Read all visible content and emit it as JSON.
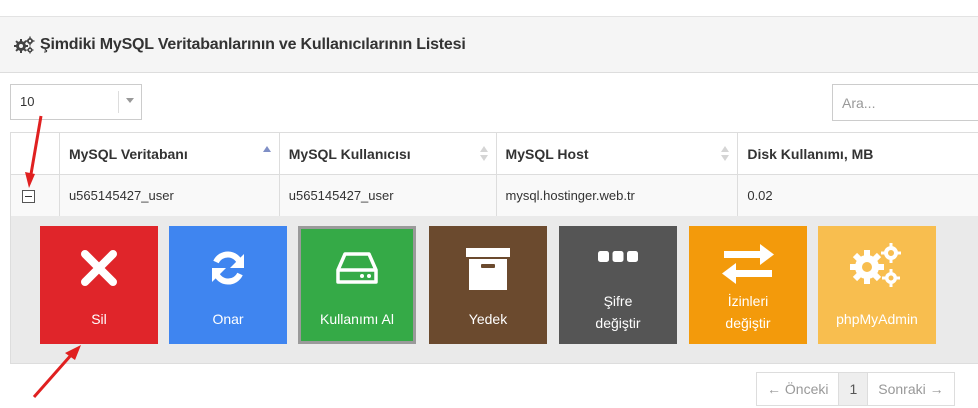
{
  "panel": {
    "title": "Şimdiki MySQL Veritabanlarının ve Kullanıcılarının Listesi",
    "icon": "gears-icon"
  },
  "length": {
    "selected": "10"
  },
  "search": {
    "placeholder": "Ara..."
  },
  "table": {
    "columns": [
      {
        "label": "MySQL Veritabanı",
        "sort": "asc"
      },
      {
        "label": "MySQL Kullanıcısı",
        "sort": "both"
      },
      {
        "label": "MySQL Host",
        "sort": "both"
      },
      {
        "label": "Disk Kullanımı, MB",
        "sort": "none"
      }
    ],
    "rows": [
      {
        "database": "u565145427_user",
        "user": "u565145427_user",
        "host": "mysql.hostinger.web.tr",
        "disk": "0.02"
      }
    ]
  },
  "actions": [
    {
      "label": "Sil",
      "icon": "close-icon",
      "color": "#e0252a"
    },
    {
      "label": "Onar",
      "icon": "refresh-icon",
      "color": "#3f85f0"
    },
    {
      "label": "Kullanımı Al",
      "icon": "hard-drive-icon",
      "color": "#35aa47"
    },
    {
      "label": "Yedek",
      "icon": "archive-icon",
      "color": "#6b4a2e"
    },
    {
      "label_line1": "Şifre",
      "label_line2": "değiştir",
      "icon": "ellipsis-icon",
      "color": "#555555"
    },
    {
      "label_line1": "İzinleri",
      "label_line2": "değiştir",
      "icon": "swap-arrows-icon",
      "color": "#f39a0b"
    },
    {
      "label": "phpMyAdmin",
      "icon": "gears-icon",
      "color": "#f8be4f"
    }
  ],
  "pagination": {
    "prev": "← Önceki",
    "current": "1",
    "next": "Sonraki →"
  },
  "annotations": {
    "color": "#e02020"
  }
}
